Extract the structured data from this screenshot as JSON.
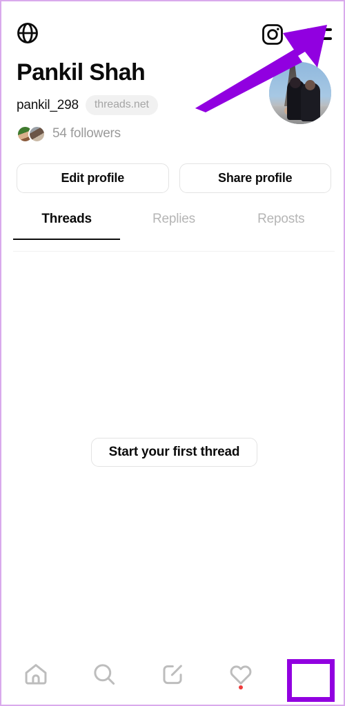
{
  "app": {
    "name": "Threads",
    "accent_purple": "#9100e0",
    "frame_border": "#d9a9ec"
  },
  "topbar": {
    "globe_icon": "globe-icon",
    "instagram_icon": "instagram-icon",
    "menu_icon": "hamburger-menu-icon"
  },
  "profile": {
    "display_name": "Pankil Shah",
    "username": "pankil_298",
    "domain_chip": "threads.net",
    "followers_text": "54 followers",
    "avatar_alt": "profile-picture"
  },
  "actions": {
    "edit_profile": "Edit profile",
    "share_profile": "Share profile"
  },
  "tabs": [
    {
      "label": "Threads",
      "active": true
    },
    {
      "label": "Replies",
      "active": false
    },
    {
      "label": "Reposts",
      "active": false
    }
  ],
  "empty_state": {
    "cta_label": "Start your first thread"
  },
  "bottom_nav": [
    {
      "name": "home",
      "icon": "home-icon",
      "active": false,
      "badge": false
    },
    {
      "name": "search",
      "icon": "search-icon",
      "active": false,
      "badge": false
    },
    {
      "name": "compose",
      "icon": "compose-icon",
      "active": false,
      "badge": false
    },
    {
      "name": "activity",
      "icon": "heart-icon",
      "active": false,
      "badge": true
    },
    {
      "name": "profile",
      "icon": "person-icon",
      "active": true,
      "badge": false
    }
  ],
  "annotation": {
    "type": "arrow",
    "color": "#9100e0",
    "points_to": "hamburger-menu-icon"
  }
}
